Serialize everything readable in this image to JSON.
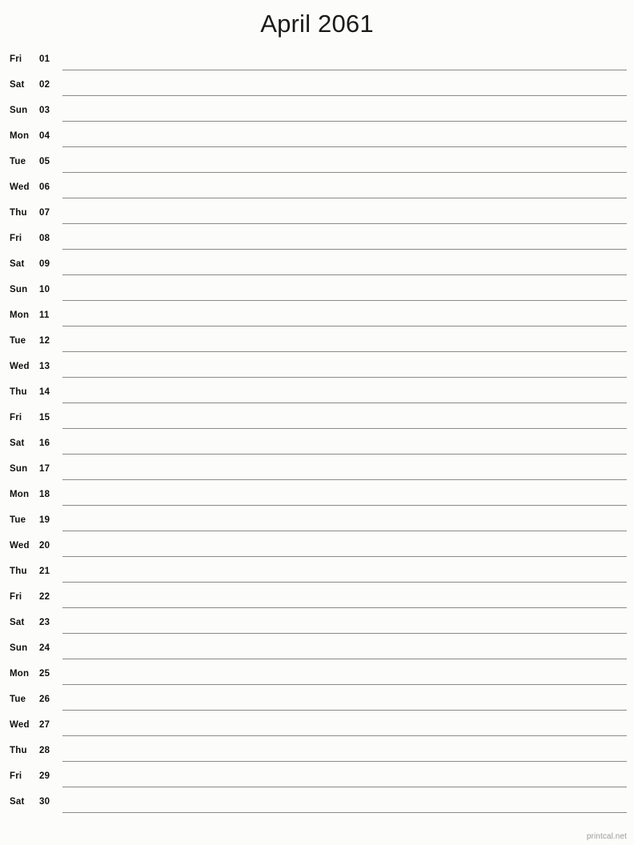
{
  "document": {
    "title": "April 2061",
    "month": "April",
    "year": "2061",
    "type": "printable-monthly-notes-calendar",
    "background_color": "#fcfdfa",
    "rule_color": "#8a8a8a",
    "text_color": "#101010"
  },
  "footer": {
    "credit": "printcal.net",
    "color": "#9a9a9a"
  },
  "calendar": {
    "day_count": 30,
    "first_weekday": "Fri",
    "last_weekday": "Sat",
    "rows": [
      {
        "weekday": "Fri",
        "day": "01"
      },
      {
        "weekday": "Sat",
        "day": "02"
      },
      {
        "weekday": "Sun",
        "day": "03"
      },
      {
        "weekday": "Mon",
        "day": "04"
      },
      {
        "weekday": "Tue",
        "day": "05"
      },
      {
        "weekday": "Wed",
        "day": "06"
      },
      {
        "weekday": "Thu",
        "day": "07"
      },
      {
        "weekday": "Fri",
        "day": "08"
      },
      {
        "weekday": "Sat",
        "day": "09"
      },
      {
        "weekday": "Sun",
        "day": "10"
      },
      {
        "weekday": "Mon",
        "day": "11"
      },
      {
        "weekday": "Tue",
        "day": "12"
      },
      {
        "weekday": "Wed",
        "day": "13"
      },
      {
        "weekday": "Thu",
        "day": "14"
      },
      {
        "weekday": "Fri",
        "day": "15"
      },
      {
        "weekday": "Sat",
        "day": "16"
      },
      {
        "weekday": "Sun",
        "day": "17"
      },
      {
        "weekday": "Mon",
        "day": "18"
      },
      {
        "weekday": "Tue",
        "day": "19"
      },
      {
        "weekday": "Wed",
        "day": "20"
      },
      {
        "weekday": "Thu",
        "day": "21"
      },
      {
        "weekday": "Fri",
        "day": "22"
      },
      {
        "weekday": "Sat",
        "day": "23"
      },
      {
        "weekday": "Sun",
        "day": "24"
      },
      {
        "weekday": "Mon",
        "day": "25"
      },
      {
        "weekday": "Tue",
        "day": "26"
      },
      {
        "weekday": "Wed",
        "day": "27"
      },
      {
        "weekday": "Thu",
        "day": "28"
      },
      {
        "weekday": "Fri",
        "day": "29"
      },
      {
        "weekday": "Sat",
        "day": "30"
      }
    ]
  }
}
